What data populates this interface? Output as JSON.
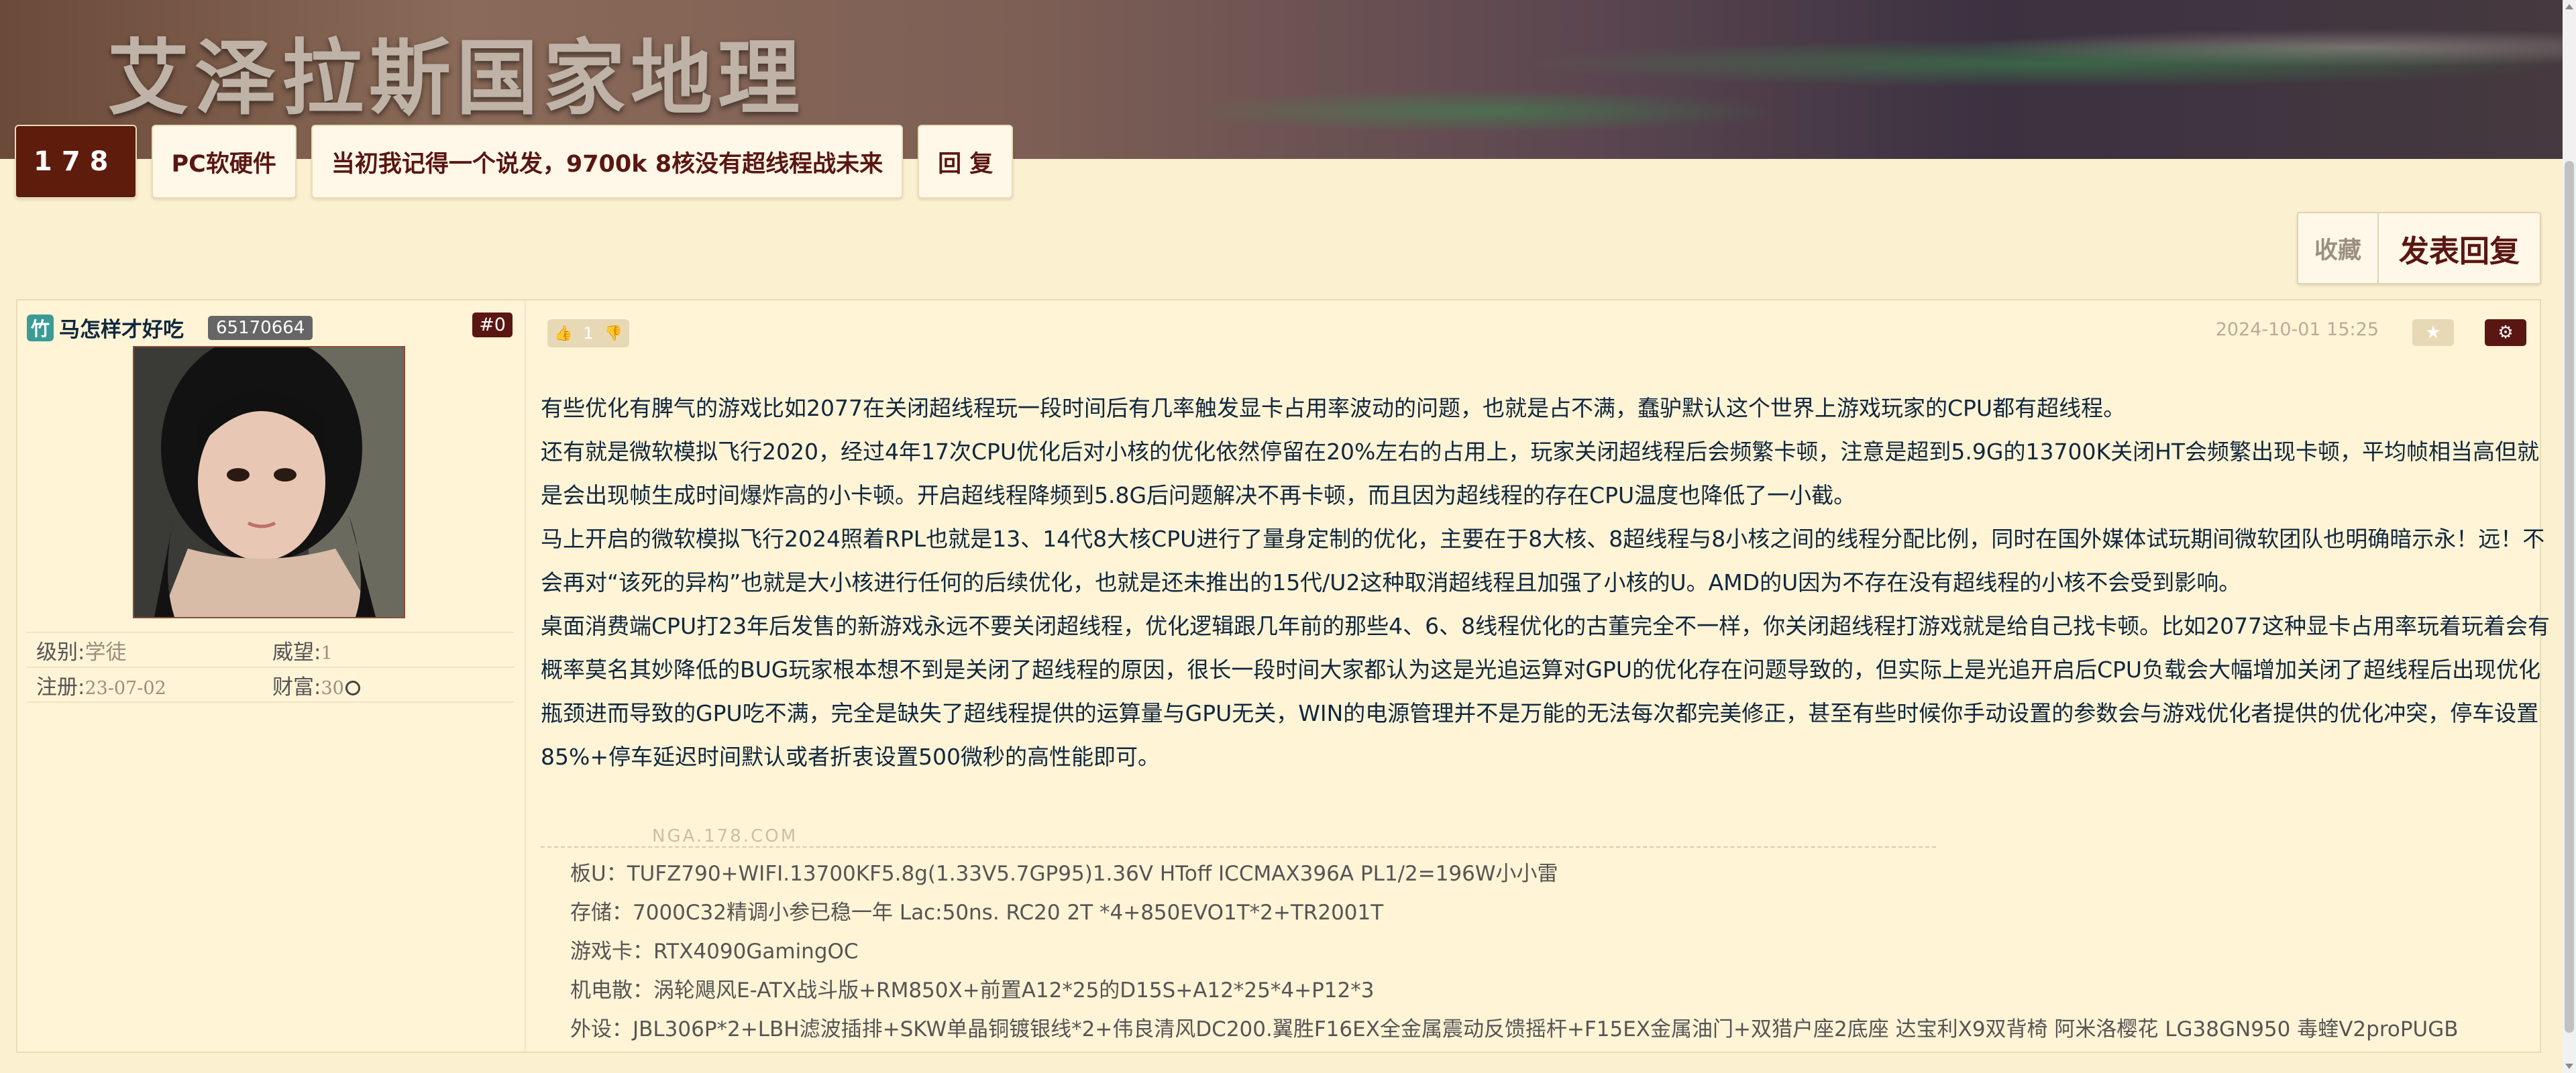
{
  "banner": {
    "site_title": "艾泽拉斯国家地理"
  },
  "nav": {
    "logo": "178",
    "items": [
      "PC软硬件",
      "当初我记得一个说发，9700k 8核没有超线程战未来",
      "回 复"
    ]
  },
  "actions": {
    "favorite_label": "收藏",
    "reply_label": "发表回复"
  },
  "post": {
    "author": {
      "name": "马怎样才好吃",
      "uid": "65170664",
      "avatar": "anime-girl-portrait",
      "level_label": "级别:",
      "level": "学徒",
      "prestige_label": "威望:",
      "prestige": "1",
      "register_label": "注册:",
      "register_date": "23-07-02",
      "wealth_label": "财富:",
      "wealth": "30"
    },
    "floor": "#0",
    "vote_count": "1",
    "timestamp": "2024-10-01 15:25",
    "paragraphs": [
      "有些优化有脾气的游戏比如2077在关闭超线程玩一段时间后有几率触发显卡占用率波动的问题，也就是占不满，蠢驴默认这个世界上游戏玩家的CPU都有超线程。",
      "还有就是微软模拟飞行2020，经过4年17次CPU优化后对小核的优化依然停留在20%左右的占用上，玩家关闭超线程后会频繁卡顿，注意是超到5.9G的13700K关闭HT会频繁出现卡顿，平均帧相当高但就是会出现帧生成时间爆炸高的小卡顿。开启超线程降频到5.8G后问题解决不再卡顿，而且因为超线程的存在CPU温度也降低了一小截。",
      "马上开启的微软模拟飞行2024照着RPL也就是13、14代8大核CPU进行了量身定制的优化，主要在于8大核、8超线程与8小核之间的线程分配比例，同时在国外媒体试玩期间微软团队也明确暗示永！远！不会再对“该死的异构”也就是大小核进行任何的后续优化，也就是还未推出的15代/U2这种取消超线程且加强了小核的U。AMD的U因为不存在没有超线程的小核不会受到影响。",
      "桌面消费端CPU打23年后发售的新游戏永远不要关闭超线程，优化逻辑跟几年前的那些4、6、8线程优化的古董完全不一样，你关闭超线程打游戏就是给自己找卡顿。比如2077这种显卡占用率玩着玩着会有概率莫名其妙降低的BUG玩家根本想不到是关闭了超线程的原因，很长一段时间大家都认为这是光追运算对GPU的优化存在问题导致的，但实际上是光追开启后CPU负载会大幅增加关闭了超线程后出现优化瓶颈进而导致的GPU吃不满，完全是缺失了超线程提供的运算量与GPU无关，WIN的电源管理并不是万能的无法每次都完美修正，甚至有些时候你手动设置的参数会与游戏优化者提供的优化冲突，停车设置85%+停车延迟时间默认或者折衷设置500微秒的高性能即可。"
    ],
    "watermark": "NGA.178.COM",
    "signature": [
      "板U：TUFZ790+WIFI.13700KF5.8g(1.33V5.7GP95)1.36V HToff ICCMAX396A PL1/2=196W小小雷",
      "存储：7000C32精调小参已稳一年 Lac:50ns. RC20 2T *4+850EVO1T*2+TR2001T",
      "游戏卡：RTX4090GamingOC",
      "机电散：涡轮飓风E-ATX战斗版+RM850X+前置A12*25的D15S+A12*25*4+P12*3",
      "外设：JBL306P*2+LBH滤波插排+SKW单晶铜镀银线*2+伟良清风DC200.翼胜F16EX全金属震动反馈摇杆+F15EX金属油门+双猎户座2底座 达宝利X9双背椅 阿米洛樱花 LG38GN950 毒蝰V2proPUGB"
    ]
  }
}
